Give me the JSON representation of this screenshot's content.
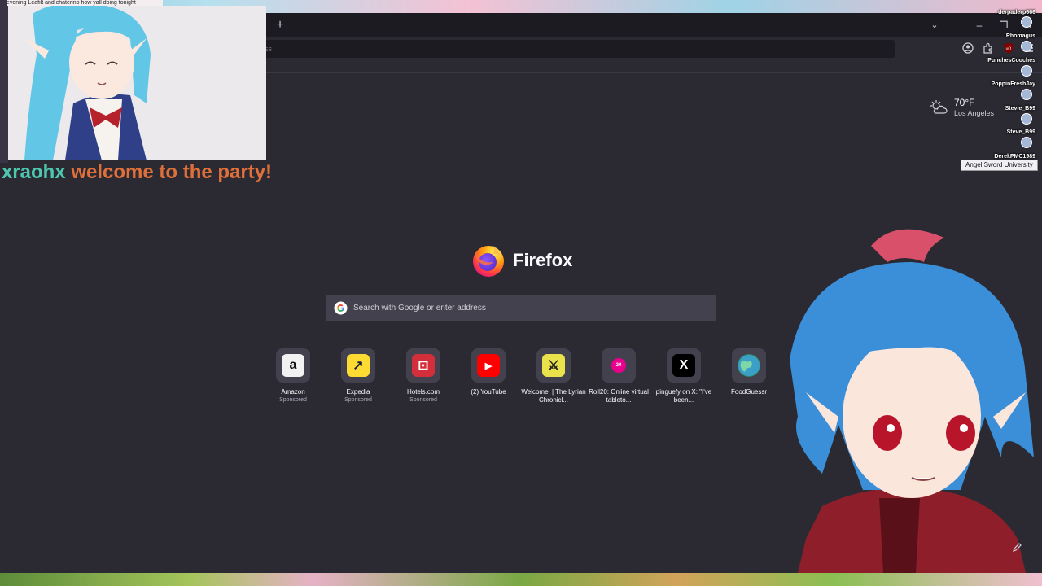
{
  "browser": {
    "new_tab_symbol": "+",
    "tab_list_symbol": "⌄",
    "window_controls": {
      "minimize": "–",
      "restore": "❐",
      "close": "✕"
    },
    "urlbar_placeholder": "ess",
    "toolbar_icons": [
      "account-icon",
      "extensions-icon",
      "ublock-icon",
      "menu-icon"
    ]
  },
  "weather": {
    "temperature": "70°F",
    "city": "Los Angeles",
    "icon": "partly-cloudy-icon"
  },
  "brand": {
    "wordmark": "Firefox"
  },
  "search": {
    "placeholder": "Search with Google or enter address"
  },
  "shortcuts": [
    {
      "title": "Amazon",
      "sponsored": "Sponsored",
      "glyph": "a",
      "bg": "#f2f2f2",
      "fg": "#111111",
      "icon": "amazon-icon"
    },
    {
      "title": "Expedia",
      "sponsored": "Sponsored",
      "glyph": "↗",
      "bg": "#fddb32",
      "fg": "#191e3b",
      "icon": "expedia-icon"
    },
    {
      "title": "Hotels.com",
      "sponsored": "Sponsored",
      "glyph": "⊡",
      "bg": "#d32f3a",
      "fg": "#ffffff",
      "icon": "hotels-icon"
    },
    {
      "title": "(2) YouTube",
      "sponsored": "",
      "glyph": "▶",
      "bg": "#ff0000",
      "fg": "#ffffff",
      "icon": "youtube-icon"
    },
    {
      "title": "Welcome! | The Lyrian Chronicl...",
      "sponsored": "",
      "glyph": "⚔",
      "bg": "#e9e24a",
      "fg": "#222222",
      "icon": "lyrian-icon"
    },
    {
      "title": "Roll20: Online virtual tableto...",
      "sponsored": "",
      "glyph": "20",
      "bg": "#42414d",
      "fg": "#e9008c",
      "icon": "roll20-icon"
    },
    {
      "title": "pinguefy on X: \"I've been...",
      "sponsored": "",
      "glyph": "X",
      "bg": "#000000",
      "fg": "#ffffff",
      "icon": "x-icon"
    },
    {
      "title": "FoodGuessr",
      "sponsored": "",
      "glyph": "●",
      "bg": "#2f8a6e",
      "fg": "#7fd6a6",
      "icon": "foodguessr-icon"
    }
  ],
  "stream": {
    "chat_top": "evening Leafilt and chaterino how yall doing tonight",
    "alert_user": "xraohx",
    "alert_message": "welcome to the party!",
    "viewers": [
      "derpaderp666",
      "Rhomagus",
      "PunchesCouches",
      "PoppinFreshJay",
      "Stevie_B99",
      "Steve_B99",
      "DerekPMC1989"
    ],
    "tooltip": "Angel Sword University"
  }
}
